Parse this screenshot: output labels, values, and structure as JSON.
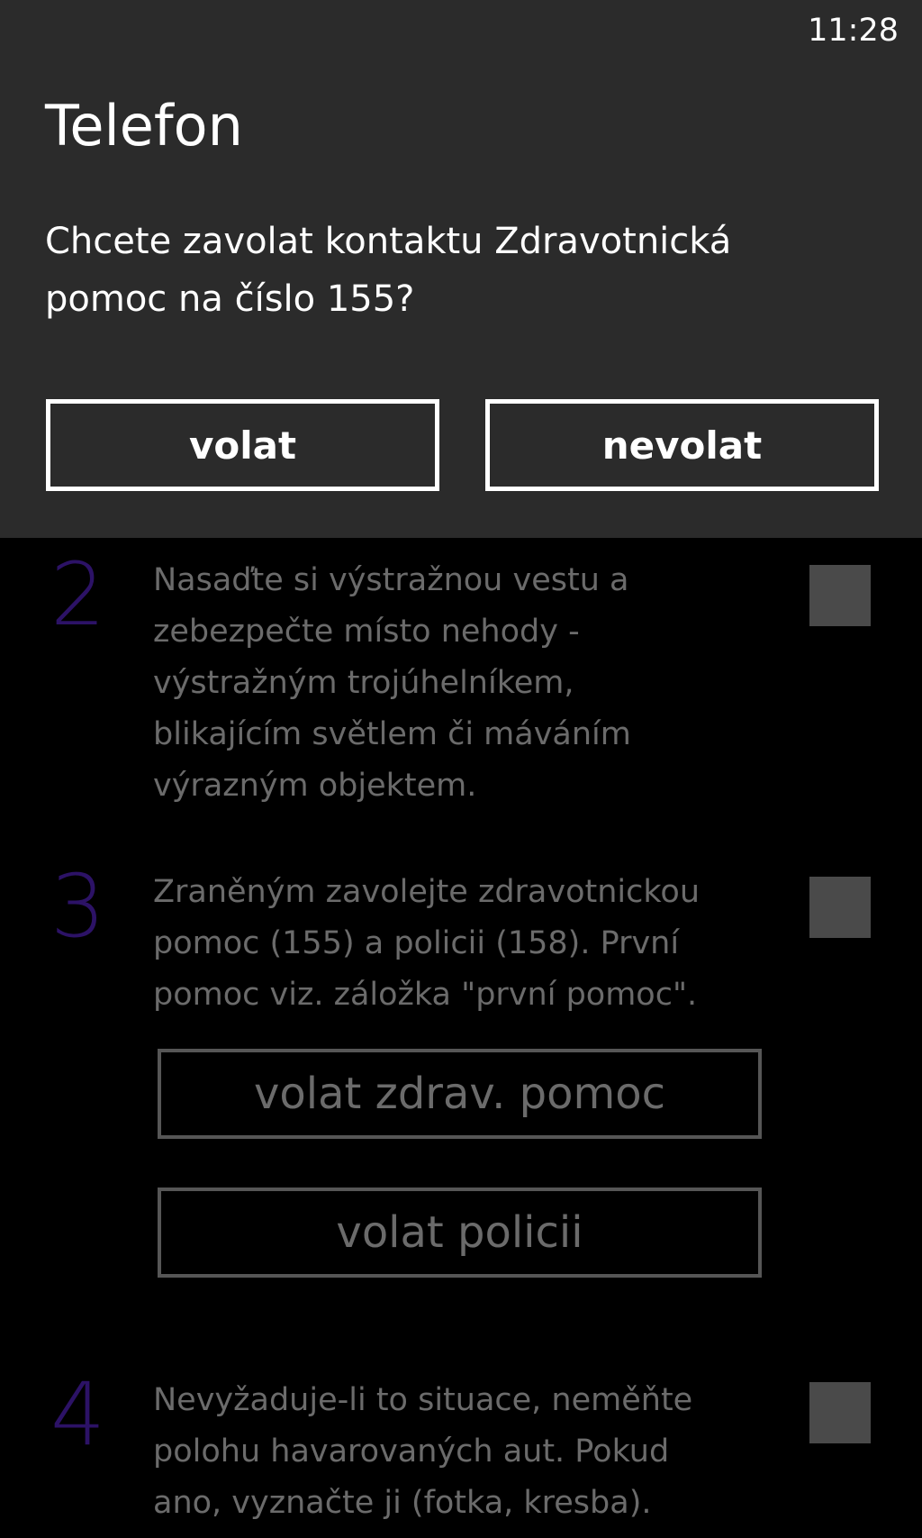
{
  "status_bar": {
    "time": "11:28"
  },
  "dialog": {
    "title": "Telefon",
    "message": "Chcete zavolat kontaktu Zdravotnická pomoc na číslo 155?",
    "buttons": {
      "call": "volat",
      "cancel": "nevolat"
    }
  },
  "steps": [
    {
      "number": "2",
      "text": "Nasaďte si výstražnou vestu a\nzebezpečte místo nehody -\nvýstražným trojúhelníkem,\nblikajícím světlem či máváním\nvýrazným objektem."
    },
    {
      "number": "3",
      "text": "Zraněným zavolejte zdravotnickou\npomoc (155) a policii (158). První\npomoc viz. záložka \"první pomoc\".",
      "buttons": {
        "call_medical": "volat zdrav. pomoc",
        "call_police": "volat policii"
      }
    },
    {
      "number": "4",
      "text": "Nevyžaduje-li to situace, neměňte\npolohu havarovaných aut. Pokud\nano, vyznačte ji (fotka, kresba)."
    }
  ],
  "colors": {
    "dialog_background": "#2b2b2b",
    "step_number": "#2c1266",
    "dimmed_text": "#6b6b6b",
    "checkbox": "#4a4a4a"
  }
}
